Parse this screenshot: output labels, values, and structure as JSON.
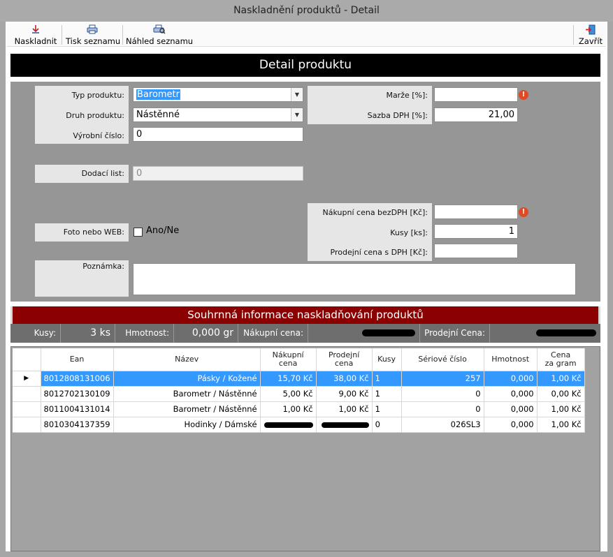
{
  "window": {
    "title": "Naskladnění produktů - Detail"
  },
  "toolbar": {
    "naskladnit": "Naskladnit",
    "tisk": "Tisk seznamu",
    "nahled": "Náhled seznamu",
    "zavrit": "Zavřít"
  },
  "detail": {
    "header": "Detail produktu",
    "typ_label": "Typ produktu:",
    "typ_value": "Barometr",
    "druh_label": "Druh produktu:",
    "druh_value": "Nástěnné",
    "vyrobni_label": "Výrobní číslo:",
    "vyrobni_value": "0",
    "dodaci_label": "Dodací list:",
    "dodaci_value": "0",
    "foto_label": "Foto nebo WEB:",
    "foto_checkbox_label": "Ano/Ne",
    "poznamka_label": "Poznámka:",
    "poznamka_value": "",
    "marze_label": "Marže [%]:",
    "marze_value": "",
    "dph_label": "Sazba DPH [%]:",
    "dph_value": "21,00",
    "nakupni_label": "Nákupní cena bezDPH [Kč]:",
    "nakupni_value": "",
    "kusy_label": "Kusy [ks]:",
    "kusy_value": "1",
    "prodejni_label": "Prodejní cena s DPH [Kč]:",
    "prodejni_value": ""
  },
  "summary": {
    "header": "Souhrnná informace naskladňování produktů",
    "kusy_label": "Kusy:",
    "kusy_value": "3 ks",
    "hmotnost_label": "Hmotnost:",
    "hmotnost_value": "0,000 gr",
    "nakupni_label": "Nákupní cena:",
    "prodejni_label": "Prodejní Cena:"
  },
  "grid": {
    "columns": [
      "Ean",
      "Název",
      "Nákupní cena",
      "Prodejní cena",
      "Kusy",
      "Sériové číslo",
      "Hmotnost",
      "Cena za gram"
    ],
    "rows": [
      {
        "ean": "8012808131006",
        "nazev": "Pásky / Kožené",
        "nakupni": "15,70 Kč",
        "prodejni": "38,00 Kč",
        "kusy": "1",
        "seriove": "257",
        "hmotnost": "0,000",
        "cena_gram": "1,00 Kč"
      },
      {
        "ean": "8012702130109",
        "nazev": "Barometr / Nástěnné",
        "nakupni": "5,00 Kč",
        "prodejni": "9,00 Kč",
        "kusy": "1",
        "seriove": "0",
        "hmotnost": "0,000",
        "cena_gram": "0,00 Kč"
      },
      {
        "ean": "8011004131014",
        "nazev": "Barometr / Nástěnné",
        "nakupni": "1,00 Kč",
        "prodejni": "1,00 Kč",
        "kusy": "1",
        "seriove": "0",
        "hmotnost": "0,000",
        "cena_gram": "1,00 Kč"
      },
      {
        "ean": "8010304137359",
        "nazev": "Hodinky / Dámské",
        "nakupni": "",
        "prodejni": "",
        "kusy": "0",
        "seriove": "026SL3",
        "hmotnost": "0,000",
        "cena_gram": "1,00 Kč"
      }
    ]
  },
  "colors": {
    "detail_header_bg": "#000000",
    "summary_header_bg": "#8b0000",
    "selection": "#3399ff",
    "error_icon": "#e04a24"
  },
  "icons": [
    "stock-in-icon",
    "print-icon",
    "print-preview-icon",
    "exit-icon",
    "error-icon",
    "row-pointer-icon"
  ]
}
